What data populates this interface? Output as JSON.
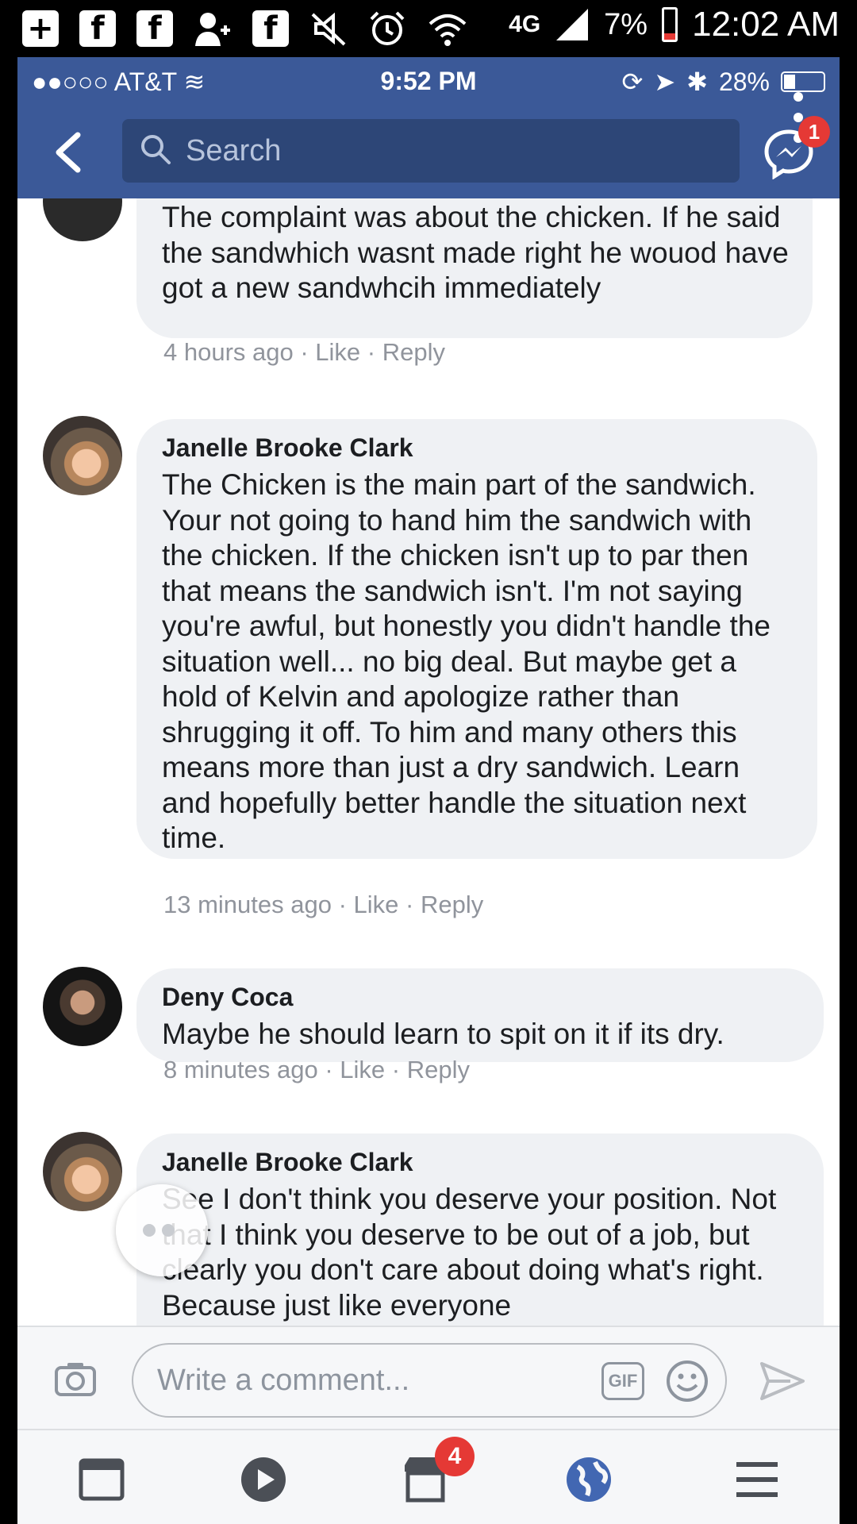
{
  "android_status": {
    "network": "4G",
    "battery": "7%",
    "time": "12:02 AM"
  },
  "ios_status": {
    "carrier": "AT&T",
    "time": "9:52 PM",
    "battery": "28%"
  },
  "header": {
    "search_placeholder": "Search",
    "messenger_badge": "1"
  },
  "comments": [
    {
      "name": "",
      "text": "The complaint was about the chicken. If he said the sandwhich wasnt made right he wouod have got a new sandwhcih immediately",
      "time": "4 hours ago",
      "like": "Like",
      "reply": "Reply"
    },
    {
      "name": "Janelle Brooke Clark",
      "text": "The Chicken is the main part of the sandwich. Your not going to hand him the sandwich with the chicken. If the chicken isn't up to par then that means the sandwich isn't. I'm not saying you're awful, but honestly you didn't handle the situation well... no big deal. But maybe get a hold of Kelvin and apologize rather than shrugging it off. To him and many others this means more than just a dry sandwich. Learn and hopefully better handle the situation next time.",
      "time": "13 minutes ago",
      "like": "Like",
      "reply": "Reply"
    },
    {
      "name": "Deny Coca",
      "text": "Maybe he should learn to spit on it if its dry.",
      "time": "8 minutes ago",
      "like": "Like",
      "reply": "Reply"
    },
    {
      "name": "Janelle Brooke Clark",
      "text": "See I don't think you deserve your position. Not that I think you deserve to be out of a job, but clearly you don't care about doing what's right. Because just like everyone",
      "time": "",
      "like": "",
      "reply": ""
    }
  ],
  "composer": {
    "placeholder": "Write a comment...",
    "gif_label": "GIF"
  },
  "bottom_nav": {
    "marketplace_badge": "4"
  },
  "colors": {
    "fb_blue": "#3b5998",
    "bubble": "#eff1f4",
    "badge": "#e53935"
  }
}
